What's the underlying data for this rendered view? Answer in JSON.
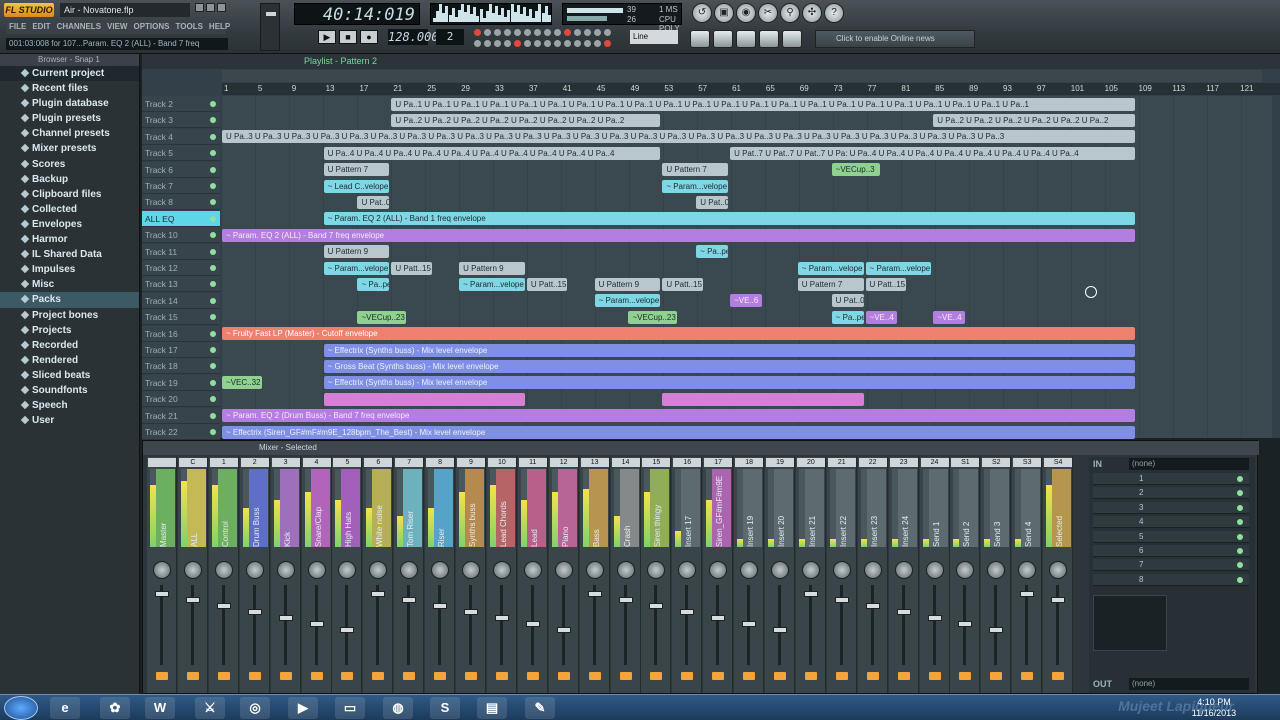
{
  "window": {
    "logo": "FL STUDIO",
    "title": "Air - Novatone.flp"
  },
  "menu": [
    "FILE",
    "EDIT",
    "CHANNELS",
    "VIEW",
    "OPTIONS",
    "TOOLS",
    "HELP"
  ],
  "hint": "001:03:008 for 107...Param. EQ 2 (ALL) - Band 7 freq",
  "transport": {
    "time": "40:14:019",
    "bpm": "128.000",
    "pattern": "2",
    "play": "▶",
    "stop": "■",
    "rec": "●",
    "line_mode": "Line"
  },
  "meter": {
    "cpu_val": "39",
    "mem_val": "26",
    "poly_label": "CPU  POLY",
    "ms": "1 MS"
  },
  "online": "Click to enable Online news",
  "browser": {
    "title": "Browser - Snap 1",
    "items": [
      "Current project",
      "Recent files",
      "Plugin database",
      "Plugin presets",
      "Channel presets",
      "Mixer presets",
      "Scores",
      "Backup",
      "Clipboard files",
      "Collected",
      "Envelopes",
      "Harmor",
      "IL Shared Data",
      "Impulses",
      "Misc",
      "Packs",
      "Project bones",
      "Projects",
      "Recorded",
      "Rendered",
      "Sliced beats",
      "Soundfonts",
      "Speech",
      "User"
    ],
    "selected": "Packs"
  },
  "playlist": {
    "title": "Playlist - Pattern 2",
    "ruler": [
      "1",
      "5",
      "9",
      "13",
      "17",
      "21",
      "25",
      "29",
      "33",
      "37",
      "41",
      "45",
      "49",
      "53",
      "57",
      "61",
      "65",
      "69",
      "73",
      "77",
      "81",
      "85",
      "89",
      "93",
      "97",
      "101",
      "105",
      "109",
      "113",
      "117",
      "121"
    ],
    "tracks": [
      "Track 2",
      "Track 3",
      "Track 4",
      "Track 5",
      "Track 6",
      "Track 7",
      "Track 8",
      "ALL EQ",
      "Track 10",
      "Track 11",
      "Track 12",
      "Track 13",
      "Track 14",
      "Track 15",
      "Track 16",
      "Track 17",
      "Track 18",
      "Track 19",
      "Track 20",
      "Track 21",
      "Track 22"
    ],
    "clips": [
      {
        "row": 0,
        "start": 21,
        "len": 88,
        "label": "U Pa..1  U Pa..1  U Pa..1  U Pa..1  U Pa..1  U Pa..1  U Pa..1  U Pa..1  U Pa..1  U Pa..1  U Pa..1  U Pa..1  U Pa..1  U Pa..1  U Pa..1  U Pa..1  U Pa..1  U Pa..1  U Pa..1  U Pa..1  U Pa..1  U Pa..1",
        "color": "grey"
      },
      {
        "row": 1,
        "start": 21,
        "len": 32,
        "label": "U Pa..2  U Pa..2  U Pa..2  U Pa..2  U Pa..2  U Pa..2  U Pa..2  U Pa..2",
        "color": "grey"
      },
      {
        "row": 1,
        "start": 85,
        "len": 24,
        "label": "U Pa..2  U Pa..2  U Pa..2  U Pa..2  U Pa..2  U Pa..2",
        "color": "grey"
      },
      {
        "row": 2,
        "start": 1,
        "len": 108,
        "label": "U Pa..3  U Pa..3  U Pa..3  U Pa..3  U Pa..3  U Pa..3  U Pa..3  U Pa..3  U Pa..3  U Pa..3  U Pa..3  U Pa..3  U Pa..3  U Pa..3  U Pa..3  U Pa..3  U Pa..3  U Pa..3  U Pa..3  U Pa..3  U Pa..3  U Pa..3  U Pa..3  U Pa..3  U Pa..3  U Pa..3  U Pa..3",
        "color": "grey"
      },
      {
        "row": 3,
        "start": 13,
        "len": 40,
        "label": "U Pa..4  U Pa..4  U Pa..4  U Pa..4  U Pa..4  U Pa..4  U Pa..4  U Pa..4  U Pa..4  U Pa..4",
        "color": "grey"
      },
      {
        "row": 3,
        "start": 61,
        "len": 48,
        "label": "U Pat..7  U Pat..7  U Pat..7  U Pa:  U Pa..4  U Pa..4  U Pa..4  U Pa..4  U Pa..4  U Pa..4  U Pa..4  U Pa..4",
        "color": "grey"
      },
      {
        "row": 4,
        "start": 13,
        "len": 8,
        "label": "U Pattern 7",
        "color": "grey"
      },
      {
        "row": 4,
        "start": 53,
        "len": 8,
        "label": "U Pattern 7",
        "color": "grey"
      },
      {
        "row": 4,
        "start": 73,
        "len": 6,
        "label": "~VECup..3",
        "color": "green"
      },
      {
        "row": 5,
        "start": 13,
        "len": 8,
        "label": "~ Lead C..velope",
        "color": "teal"
      },
      {
        "row": 5,
        "start": 53,
        "len": 8,
        "label": "~ Param...velope",
        "color": "teal"
      },
      {
        "row": 6,
        "start": 17,
        "len": 4,
        "label": "U Pat..0",
        "color": "grey"
      },
      {
        "row": 6,
        "start": 57,
        "len": 4,
        "label": "U Pat..0",
        "color": "grey"
      },
      {
        "row": 7,
        "start": 13,
        "len": 96,
        "label": "~ Param. EQ 2 (ALL) - Band 1 freq envelope",
        "color": "teal"
      },
      {
        "row": 8,
        "start": 1,
        "len": 108,
        "label": "~ Param. EQ 2 (ALL) - Band 7 freq envelope",
        "color": "purple"
      },
      {
        "row": 9,
        "start": 13,
        "len": 8,
        "label": "U Pattern 9",
        "color": "grey"
      },
      {
        "row": 9,
        "start": 57,
        "len": 4,
        "label": "~ Pa..pe",
        "color": "teal"
      },
      {
        "row": 10,
        "start": 13,
        "len": 8,
        "label": "~ Param...velope",
        "color": "teal"
      },
      {
        "row": 10,
        "start": 21,
        "len": 5,
        "label": "U Patt..15",
        "color": "grey"
      },
      {
        "row": 10,
        "start": 29,
        "len": 8,
        "label": "U Pattern 9",
        "color": "grey"
      },
      {
        "row": 10,
        "start": 69,
        "len": 8,
        "label": "~ Param...velope",
        "color": "teal"
      },
      {
        "row": 10,
        "start": 77,
        "len": 8,
        "label": "~ Param...velope",
        "color": "teal"
      },
      {
        "row": 11,
        "start": 17,
        "len": 4,
        "label": "~ Pa..pe",
        "color": "teal"
      },
      {
        "row": 11,
        "start": 29,
        "len": 8,
        "label": "~ Param...velope",
        "color": "teal"
      },
      {
        "row": 11,
        "start": 37,
        "len": 5,
        "label": "U Patt..15",
        "color": "grey"
      },
      {
        "row": 11,
        "start": 45,
        "len": 8,
        "label": "U Pattern 9",
        "color": "grey"
      },
      {
        "row": 11,
        "start": 53,
        "len": 5,
        "label": "U Patt..15",
        "color": "grey"
      },
      {
        "row": 11,
        "start": 69,
        "len": 8,
        "label": "U Pattern 7",
        "color": "grey"
      },
      {
        "row": 11,
        "start": 77,
        "len": 5,
        "label": "U Patt..15",
        "color": "grey"
      },
      {
        "row": 12,
        "start": 45,
        "len": 8,
        "label": "~ Param...velope",
        "color": "teal"
      },
      {
        "row": 12,
        "start": 61,
        "len": 4,
        "label": "~VE..6",
        "color": "purple"
      },
      {
        "row": 12,
        "start": 73,
        "len": 4,
        "label": "U Pat..0",
        "color": "grey"
      },
      {
        "row": 13,
        "start": 17,
        "len": 6,
        "label": "~VECup..23",
        "color": "green"
      },
      {
        "row": 13,
        "start": 49,
        "len": 6,
        "label": "~VECup..23",
        "color": "green"
      },
      {
        "row": 13,
        "start": 73,
        "len": 4,
        "label": "~ Pa..pe",
        "color": "teal"
      },
      {
        "row": 13,
        "start": 77,
        "len": 4,
        "label": "~VE..4",
        "color": "purple"
      },
      {
        "row": 13,
        "start": 85,
        "len": 4,
        "label": "~VE..4",
        "color": "purple"
      },
      {
        "row": 14,
        "start": 1,
        "len": 108,
        "label": "~ Fruity Fast LP (Master) - Cutoff envelope",
        "color": "red"
      },
      {
        "row": 15,
        "start": 13,
        "len": 96,
        "label": "~ Effectrix (Synths buss) - Mix level envelope",
        "color": "blue"
      },
      {
        "row": 16,
        "start": 13,
        "len": 96,
        "label": "~ Gross Beat (Synths buss) - Mix level envelope",
        "color": "blue"
      },
      {
        "row": 17,
        "start": 1,
        "len": 5,
        "label": "~VEC..32",
        "color": "green"
      },
      {
        "row": 17,
        "start": 13,
        "len": 96,
        "label": "~ Effectrix (Synths buss) - Mix level envelope",
        "color": "blue"
      },
      {
        "row": 18,
        "start": 13,
        "len": 24,
        "label": "",
        "color": "pink"
      },
      {
        "row": 18,
        "start": 53,
        "len": 24,
        "label": "",
        "color": "pink"
      },
      {
        "row": 19,
        "start": 1,
        "len": 108,
        "label": "~ Param. EQ 2 (Drum Buss) - Band 7 freq envelope",
        "color": "purple"
      },
      {
        "row": 20,
        "start": 1,
        "len": 108,
        "label": "~ Effectrix (Siren_GF#mF#m9E_128bpm_The_Best) - Mix level envelope",
        "color": "blue"
      }
    ]
  },
  "mixer": {
    "title": "Mixer - Selected",
    "in_label": "IN",
    "in_value": "(none)",
    "out_label": "OUT",
    "out_value": "(none)",
    "none_label": "None",
    "slots": [
      "1",
      "2",
      "3",
      "4",
      "5",
      "6",
      "7",
      "8"
    ],
    "strips": [
      {
        "num": "",
        "name": "Master",
        "color": "#7dd36a",
        "level": 0.8
      },
      {
        "num": "C",
        "name": "ALL",
        "color": "#f2e25a",
        "level": 0.85
      },
      {
        "num": "1",
        "name": "Control",
        "color": "#7dd36a",
        "level": 0.8
      },
      {
        "num": "2",
        "name": "Drum Buss",
        "color": "#6c7cf0",
        "level": 0.5
      },
      {
        "num": "3",
        "name": "Kick",
        "color": "#c07de0",
        "level": 0.6
      },
      {
        "num": "4",
        "name": "Snare/Clap",
        "color": "#d970e0",
        "level": 0.7
      },
      {
        "num": "5",
        "name": "High Hats",
        "color": "#c66ae0",
        "level": 0.6
      },
      {
        "num": "6",
        "name": "White noise",
        "color": "#e0d35a",
        "level": 0.5
      },
      {
        "num": "7",
        "name": "Tom Riser",
        "color": "#7fd6e4",
        "level": 0.4
      },
      {
        "num": "8",
        "name": "Riser",
        "color": "#5fc3f0",
        "level": 0.5
      },
      {
        "num": "9",
        "name": "Synths buss",
        "color": "#e0a050",
        "level": 0.7
      },
      {
        "num": "10",
        "name": "Lead Chords",
        "color": "#e07070",
        "level": 0.8
      },
      {
        "num": "11",
        "name": "Lead",
        "color": "#e06aa0",
        "level": 0.6
      },
      {
        "num": "12",
        "name": "Piano",
        "color": "#e070b0",
        "level": 0.7
      },
      {
        "num": "13",
        "name": "Bass",
        "color": "#e0b050",
        "level": 0.75
      },
      {
        "num": "14",
        "name": "Crash",
        "color": "#a0a0a0",
        "level": 0.4
      },
      {
        "num": "15",
        "name": "Siren thingy",
        "color": "#b0d060",
        "level": 0.7
      },
      {
        "num": "16",
        "name": "Insert 17",
        "color": "#6a787e",
        "level": 0.2
      },
      {
        "num": "17",
        "name": "Siren_GF#mF#m9E",
        "color": "#d070d0",
        "level": 0.6
      },
      {
        "num": "18",
        "name": "Insert 19",
        "color": "#6a787e",
        "level": 0.1
      },
      {
        "num": "19",
        "name": "Insert 20",
        "color": "#6a787e",
        "level": 0.1
      },
      {
        "num": "20",
        "name": "Insert 21",
        "color": "#6a787e",
        "level": 0.1
      },
      {
        "num": "21",
        "name": "Insert 22",
        "color": "#6a787e",
        "level": 0.1
      },
      {
        "num": "22",
        "name": "Insert 23",
        "color": "#6a787e",
        "level": 0.1
      },
      {
        "num": "23",
        "name": "Insert 24",
        "color": "#6a787e",
        "level": 0.1
      },
      {
        "num": "24",
        "name": "Send 1",
        "color": "#6a787e",
        "level": 0.1
      },
      {
        "num": "S1",
        "name": "Send 2",
        "color": "#6a787e",
        "level": 0.1
      },
      {
        "num": "S2",
        "name": "Send 3",
        "color": "#6a787e",
        "level": 0.1
      },
      {
        "num": "S3",
        "name": "Send 4",
        "color": "#6a787e",
        "level": 0.1
      },
      {
        "num": "S4",
        "name": "Selected",
        "color": "#e0b050",
        "level": 0.8
      }
    ]
  },
  "taskbar": {
    "time": "4:10 PM",
    "date": "11/16/2013",
    "watermark": "Mujeet Lapiqueur"
  }
}
